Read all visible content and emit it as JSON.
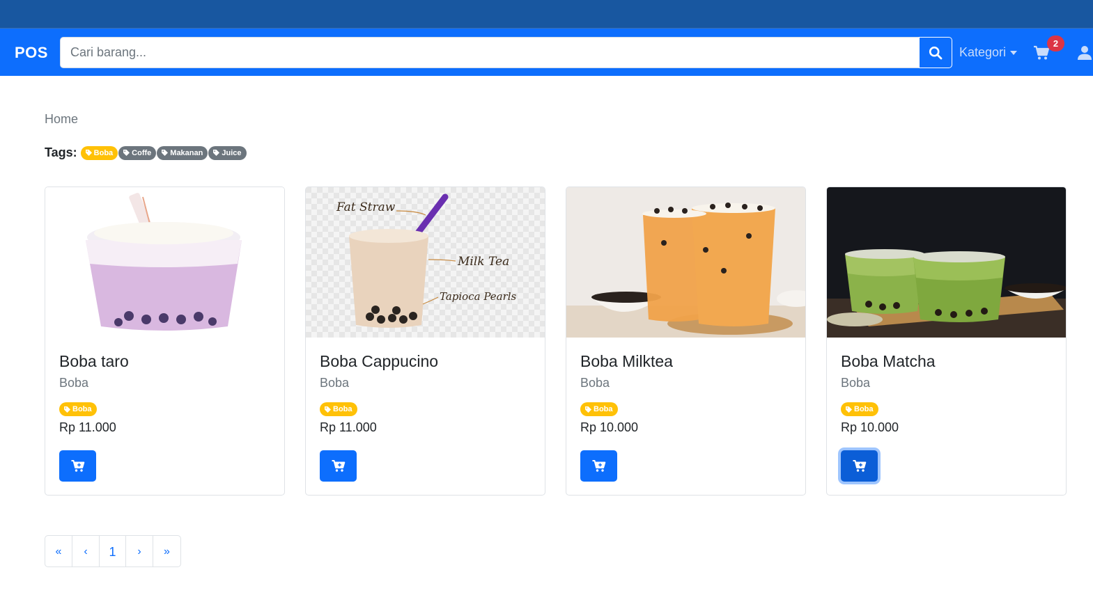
{
  "navbar": {
    "brand": "POS",
    "search_placeholder": "Cari barang...",
    "kategori_label": "Kategori",
    "cart_count": "2"
  },
  "breadcrumb": "Home",
  "tags": {
    "label": "Tags:",
    "items": [
      {
        "label": "Boba",
        "variant": "warning"
      },
      {
        "label": "Coffe",
        "variant": "secondary"
      },
      {
        "label": "Makanan",
        "variant": "secondary"
      },
      {
        "label": "Juice",
        "variant": "secondary"
      }
    ]
  },
  "products": [
    {
      "name": "Boba taro",
      "category": "Boba",
      "tag": "Boba",
      "price": "Rp 11.000"
    },
    {
      "name": "Boba Cappucino",
      "category": "Boba",
      "tag": "Boba",
      "price": "Rp 11.000"
    },
    {
      "name": "Boba Milktea",
      "category": "Boba",
      "tag": "Boba",
      "price": "Rp 10.000"
    },
    {
      "name": "Boba Matcha",
      "category": "Boba",
      "tag": "Boba",
      "price": "Rp 10.000"
    }
  ],
  "cappucino_image_labels": {
    "straw": "Fat Straw",
    "tea": "Milk Tea",
    "pearls": "Tapioca Pearls"
  },
  "pagination": {
    "first": "«",
    "prev": "‹",
    "page": "1",
    "next": "›",
    "last": "»"
  },
  "colors": {
    "primary": "#0d6efd",
    "topstrip": "#1857a0",
    "warning": "#ffc107",
    "secondary": "#6c757d",
    "danger": "#dc3545"
  }
}
